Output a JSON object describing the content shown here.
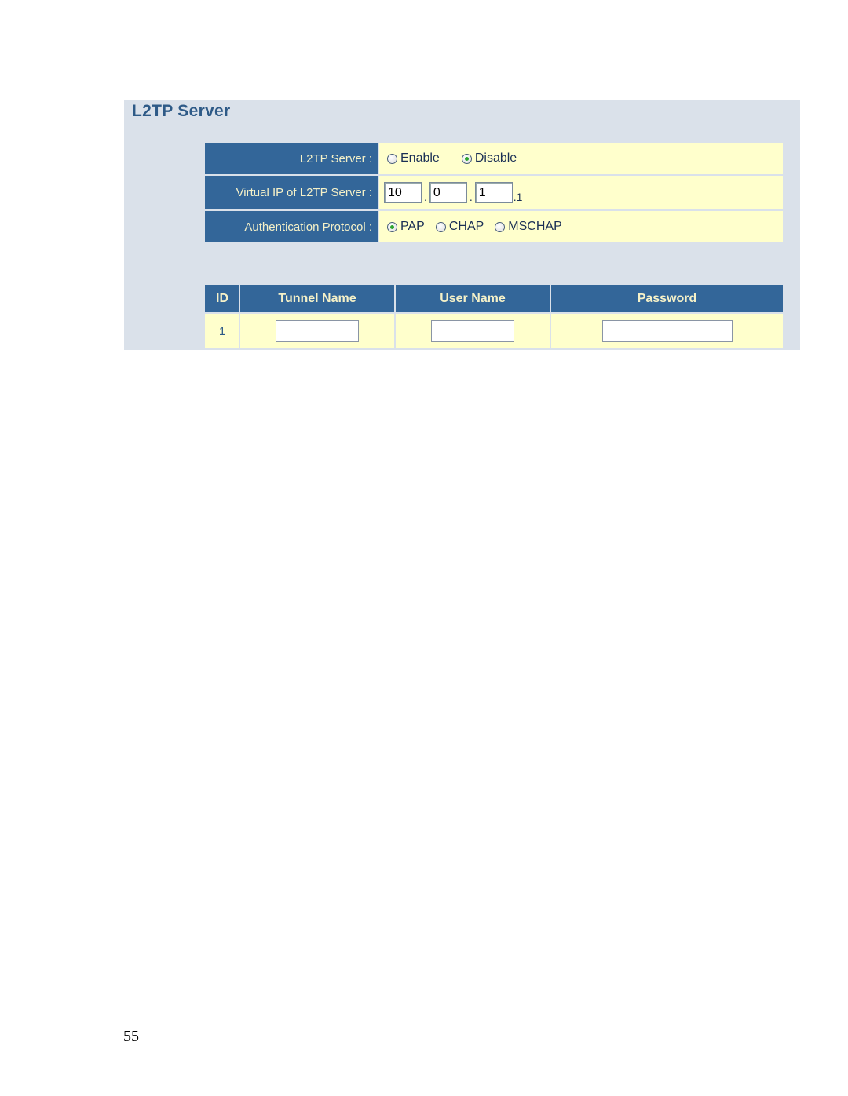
{
  "panel": {
    "title": "L2TP Server",
    "colors": {
      "header_bg": "#336699",
      "cell_bg": "#ffffcc",
      "panel_bg": "#dae1ea",
      "title": "#2e5a87"
    }
  },
  "form": {
    "server": {
      "label": "L2TP Server :",
      "options": [
        {
          "label": "Enable",
          "checked": false
        },
        {
          "label": "Disable",
          "checked": true
        }
      ]
    },
    "virtual_ip": {
      "label": "Virtual IP of L2TP Server :",
      "octets": [
        "10",
        "0",
        "1"
      ],
      "separator": ".",
      "suffix": ".1"
    },
    "auth": {
      "label": "Authentication Protocol :",
      "options": [
        {
          "label": "PAP",
          "checked": true
        },
        {
          "label": "CHAP",
          "checked": false
        },
        {
          "label": "MSCHAP",
          "checked": false
        }
      ]
    }
  },
  "tunnel_table": {
    "headers": [
      "ID",
      "Tunnel Name",
      "User Name",
      "Password"
    ],
    "rows": [
      {
        "id": "1",
        "tunnel_name": "",
        "user_name": "",
        "password": ""
      }
    ]
  },
  "page_number": "55"
}
